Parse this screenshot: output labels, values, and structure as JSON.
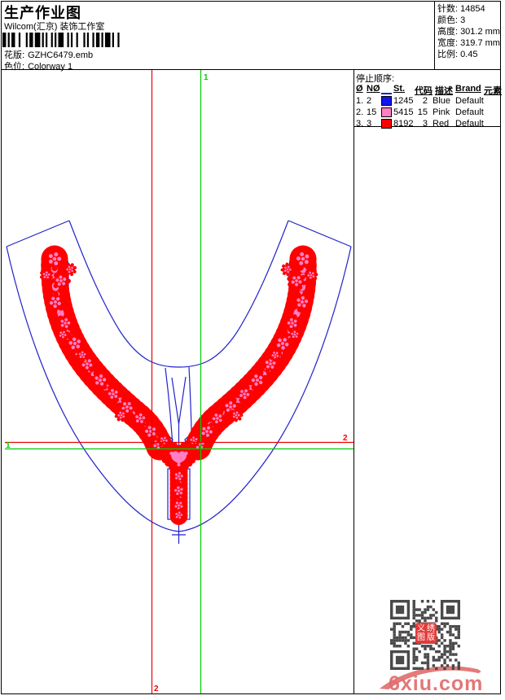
{
  "header": {
    "title": "生产作业图",
    "studio": "Wilcom(汇京) 装饰工作室",
    "design_label": "花版:",
    "design_value": "GZHC6479.emb",
    "colorway_label": "色位:",
    "colorway_value": "Colorway 1"
  },
  "stats": {
    "stitches_label": "针数:",
    "stitches_value": "14854",
    "colors_label": "颜色:",
    "colors_value": "3",
    "height_label": "高度:",
    "height_value": "301.2 mm",
    "width_label": "宽度:",
    "width_value": "319.7 mm",
    "scale_label": "比例:",
    "scale_value": "0.45"
  },
  "stop_sequence": {
    "title": "停止顺序:",
    "columns": [
      "Ø",
      "NØ",
      "St.",
      "代码",
      "描述",
      "Brand",
      "元素"
    ],
    "rows": [
      {
        "seq": "1.",
        "needle": "2",
        "chip": "#1414ee",
        "st": "1245",
        "code": "2",
        "desc": "Blue",
        "brand": "Default"
      },
      {
        "seq": "2.",
        "needle": "15",
        "chip": "#ff7fc4",
        "st": "5415",
        "code": "15",
        "desc": "Pink",
        "brand": "Default"
      },
      {
        "seq": "3.",
        "needle": "3",
        "chip": "#ff0000",
        "st": "8192",
        "code": "3",
        "desc": "Red",
        "brand": "Default"
      }
    ]
  },
  "canvas_labels": {
    "green_top": "1",
    "green_left": "1",
    "red_right": "2",
    "red_bottom": "2"
  },
  "watermark": {
    "site": "6xiu.com",
    "seal_chars": [
      "义",
      "绣",
      "图",
      "版"
    ]
  },
  "colors": {
    "outline_blue": "#2222cc",
    "stitch_red": "#ff0000",
    "stitch_pink": "#ff7fc4",
    "guide_green": "#00cc00",
    "guide_red": "#ee0000",
    "qr_gray": "#4a4a4a",
    "seal_red": "#e23b3b",
    "watermark_pink": "#e06d6d"
  }
}
